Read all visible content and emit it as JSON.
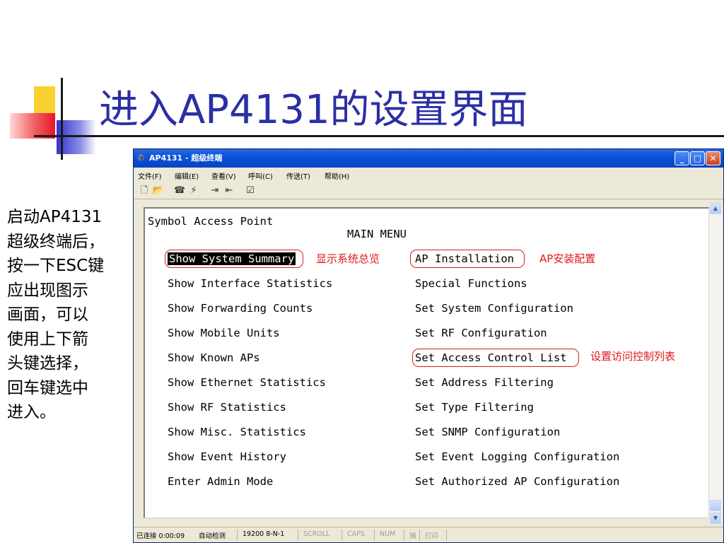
{
  "slide": {
    "title": "进入AP4131的设置界面",
    "side_text": "启动AP4131\n超级终端后，\n按一下ESC键\n应出现图示\n画面，可以\n使用上下箭\n头键选择，\n回车键选中\n进入。"
  },
  "window": {
    "title": "AP4131 - 超级终端",
    "menu": [
      "文件(F)",
      "编辑(E)",
      "查看(V)",
      "呼叫(C)",
      "传送(T)",
      "帮助(H)"
    ],
    "toolbar_icons": [
      "new-icon",
      "open-icon",
      "call-icon",
      "disconnect-icon",
      "send-icon",
      "receive-icon",
      "properties-icon"
    ]
  },
  "terminal": {
    "header": "Symbol Access Point",
    "menu_title": "MAIN MENU",
    "left_items": [
      "Show System Summary",
      "Show Interface Statistics",
      "Show Forwarding Counts",
      "Show Mobile Units",
      "Show Known APs",
      "Show Ethernet Statistics",
      "Show RF Statistics",
      "Show Misc. Statistics",
      "Show Event History",
      "Enter Admin Mode"
    ],
    "right_items": [
      "AP Installation",
      "Special Functions",
      "Set System Configuration",
      "Set RF Configuration",
      "Set Access Control List",
      "Set Address Filtering",
      "Set Type Filtering",
      "Set SNMP Configuration",
      "Set Event Logging Configuration",
      "Set Authorized AP Configuration"
    ],
    "annotations": {
      "system_summary": "显示系统总览",
      "ap_installation": "AP安装配置",
      "access_control": "设置访问控制列表"
    }
  },
  "status": {
    "connected": "已连接 0:00:09",
    "detect": "自动检测",
    "baud": "19200 8-N-1",
    "scroll": "SCROLL",
    "caps": "CAPS",
    "num": "NUM",
    "capture": "捕",
    "print": "打印"
  },
  "colors": {
    "title": "#2a2fa5",
    "annotation": "#e01818",
    "titlebar": "#0a53d8"
  }
}
